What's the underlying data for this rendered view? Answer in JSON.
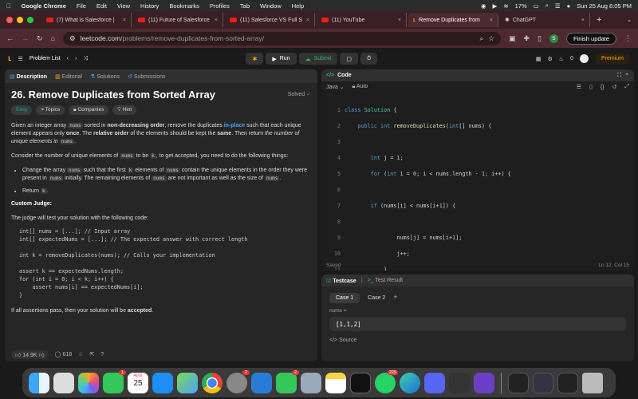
{
  "menubar": {
    "app": "Google Chrome",
    "items": [
      "File",
      "Edit",
      "View",
      "History",
      "Bookmarks",
      "Profiles",
      "Tab",
      "Window",
      "Help"
    ],
    "battery": "17%",
    "datetime": "Sun 25 Aug  8:05 PM"
  },
  "tabs": [
    {
      "title": "(7) What is Salesforce |",
      "icon": "youtube-icon"
    },
    {
      "title": "(11) Future of Salesforce",
      "icon": "youtube-icon"
    },
    {
      "title": "(11) Salesforce VS Full S",
      "icon": "youtube-icon"
    },
    {
      "title": "(11) YouTube",
      "icon": "youtube-icon"
    },
    {
      "title": "Remove Duplicates from",
      "icon": "leetcode-icon"
    },
    {
      "title": "ChatGPT",
      "icon": "chatgpt-icon"
    }
  ],
  "address": {
    "host": "leetcode.com",
    "path": "/problems/remove-duplicates-from-sorted-array/",
    "finish_update": "Finish update",
    "avatar_letter": "S"
  },
  "lc": {
    "problem_list": "Problem List",
    "run": "Run",
    "submit": "Submit",
    "streak": "0",
    "premium": "Premium"
  },
  "left": {
    "tabs": [
      "Description",
      "Editorial",
      "Solutions",
      "Submissions"
    ],
    "title": "26. Remove Duplicates from Sorted Array",
    "solved": "Solved",
    "chips": [
      "Easy",
      "Topics",
      "Companies",
      "Hint"
    ],
    "p1a": "Given an integer array ",
    "p1code": "nums",
    "p1b": " sorted in ",
    "p1bold": "non-decreasing order",
    "p1c": ", remove the duplicates ",
    "p1inplace": "in-place",
    "p1d": " such that each unique element appears only ",
    "p1once": "once",
    "p1e": ". The ",
    "p1rel": "relative order",
    "p1f": " of the elements should be kept the ",
    "p1same": "same",
    "p1g": ". Then return ",
    "p1it": "the number of unique elements in ",
    "p1code2": "nums",
    "p1h": ".",
    "p2a": "Consider the number of unique elements of ",
    "p2code": "nums",
    "p2b": " to be ",
    "p2k": "k",
    "p2c": ", to get accepted, you need to do the following things:",
    "b1a": "Change the array ",
    "b1code": "nums",
    "b1b": " such that the first ",
    "b1k": "k",
    "b1c": " elements of ",
    "b1code2": "nums",
    "b1d": " contain the unique elements in the order they were present in ",
    "b1code3": "nums",
    "b1e": " initially. The remaining elements of ",
    "b1code4": "nums",
    "b1f": " are not important as well as the size of ",
    "b1code5": "nums",
    "b1g": ".",
    "b2a": "Return ",
    "b2k": "k",
    "b2b": ".",
    "judge_title": "Custom Judge:",
    "judge_text": "The judge will test your solution with the following code:",
    "judge_code": "int[] nums = [...]; // Input array\nint[] expectedNums = [...]; // The expected answer with correct length\n\nint k = removeDuplicates(nums); // Calls your implementation\n\nassert k == expectedNums.length;\nfor (int i = 0; i < k; i++) {\n    assert nums[i] == expectedNums[i];\n}",
    "final_a": "If all assertions pass, then your solution will be ",
    "final_b": "accepted",
    "final_c": ".",
    "likes": "14.9K",
    "comments": "618"
  },
  "code": {
    "header": "Code",
    "lang": "Java",
    "mode": "Auto",
    "saved": "Saved",
    "cursor": "Ln 12, Col 15"
  },
  "test": {
    "tab1": "Testcase",
    "tab2": "Test Result",
    "case1": "Case 1",
    "case2": "Case 2",
    "label": "nums =",
    "value": "[1,1,2]",
    "source": "Source"
  },
  "dock": {
    "badges": {
      "facetime": "1",
      "calendar_month": "AUG",
      "calendar_day": "25",
      "settings": "2",
      "messages": "2",
      "whatsapp": "229"
    }
  }
}
